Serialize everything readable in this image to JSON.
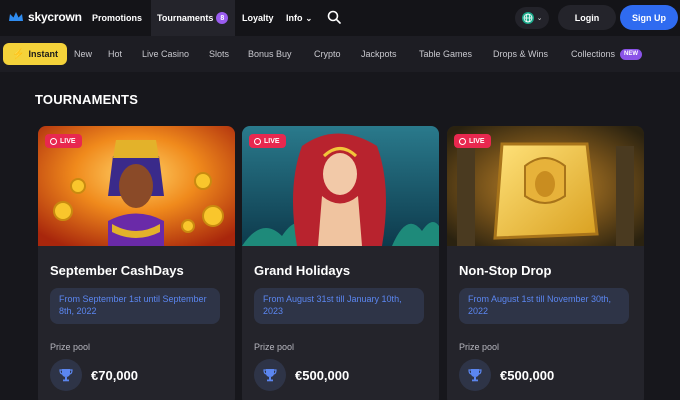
{
  "header": {
    "logo_text": "skycrown",
    "nav": [
      {
        "label": "Promotions"
      },
      {
        "label": "Tournaments",
        "badge": "8"
      },
      {
        "label": "Loyalty"
      },
      {
        "label": "Info"
      }
    ],
    "login_label": "Login",
    "signup_label": "Sign Up"
  },
  "categories": {
    "instant_label": "Instant",
    "items": [
      "New",
      "Hot",
      "Live Casino",
      "Slots",
      "Bonus Buy",
      "Crypto",
      "Jackpots",
      "Table Games",
      "Drops & Wins",
      "Collections"
    ],
    "new_badge": "NEW"
  },
  "section_title": "TOURNAMENTS",
  "cards": [
    {
      "live": "LIVE",
      "title": "September CashDays",
      "dates": "From September 1st until September 8th, 2022",
      "prize_label": "Prize pool",
      "prize": "€70,000"
    },
    {
      "live": "LIVE",
      "title": "Grand Holidays",
      "dates": "From August 31st till January 10th, 2023",
      "prize_label": "Prize pool",
      "prize": "€500,000"
    },
    {
      "live": "LIVE",
      "title": "Non-Stop Drop",
      "dates": "From August 1st till November 30th, 2022",
      "prize_label": "Prize pool",
      "prize": "€500,000"
    }
  ],
  "colors": {
    "accent_blue": "#2f6bf0",
    "instant_yellow": "#f4d23a",
    "live_red": "#e8284f",
    "badge_purple": "#9a5cf0"
  }
}
